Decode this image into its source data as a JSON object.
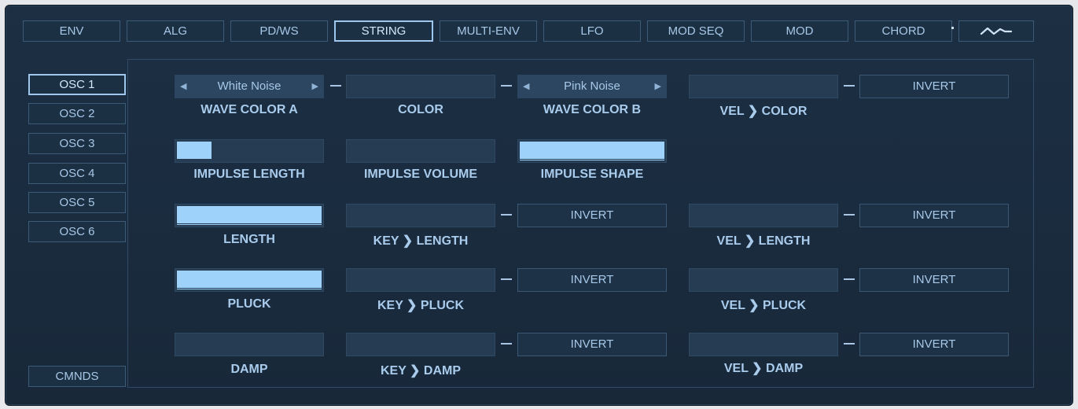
{
  "tabs": [
    {
      "label": "ENV"
    },
    {
      "label": "ALG"
    },
    {
      "label": "PD/WS"
    },
    {
      "label": "STRING"
    },
    {
      "label": "MULTI-ENV"
    },
    {
      "label": "LFO"
    },
    {
      "label": "MOD SEQ"
    },
    {
      "label": "MOD"
    },
    {
      "label": "CHORD"
    }
  ],
  "active_tab": "STRING",
  "wave_tab_icon": "waveform-icon",
  "oscillators": [
    {
      "label": "OSC 1"
    },
    {
      "label": "OSC 2"
    },
    {
      "label": "OSC 3"
    },
    {
      "label": "OSC 4"
    },
    {
      "label": "OSC 5"
    },
    {
      "label": "OSC 6"
    }
  ],
  "active_osc": "OSC 1",
  "cmnds_label": "CMNDS",
  "wave_color_a": {
    "value": "White Noise",
    "label": "WAVE COLOR A"
  },
  "color": {
    "label": "COLOR",
    "level": 0
  },
  "wave_color_b": {
    "value": "Pink Noise",
    "label": "WAVE COLOR B"
  },
  "vel_color": {
    "label": "VEL ❯ COLOR",
    "level": 0,
    "invert": "INVERT"
  },
  "impulse_length": {
    "label": "IMPULSE LENGTH",
    "level": 0.24
  },
  "impulse_volume": {
    "label": "IMPULSE VOLUME",
    "level": 0
  },
  "impulse_shape": {
    "label": "IMPULSE SHAPE",
    "level": 1
  },
  "length": {
    "label": "LENGTH",
    "level": 1
  },
  "key_length": {
    "label": "KEY ❯ LENGTH",
    "level": 0,
    "invert": "INVERT"
  },
  "vel_length": {
    "label": "VEL ❯ LENGTH",
    "level": 0,
    "invert": "INVERT"
  },
  "pluck": {
    "label": "PLUCK",
    "level": 1
  },
  "key_pluck": {
    "label": "KEY ❯ PLUCK",
    "level": 0,
    "invert": "INVERT"
  },
  "vel_pluck": {
    "label": "VEL ❯ PLUCK",
    "level": 0,
    "invert": "INVERT"
  },
  "damp": {
    "label": "DAMP",
    "level": 0
  },
  "key_damp": {
    "label": "KEY ❯ DAMP",
    "level": 0,
    "invert": "INVERT"
  },
  "vel_damp": {
    "label": "VEL ❯ DAMP",
    "level": 0,
    "invert": "INVERT"
  },
  "colors": {
    "accent": "#9ed2fb",
    "panel": "#1b2d40",
    "text": "#a9cbec"
  }
}
